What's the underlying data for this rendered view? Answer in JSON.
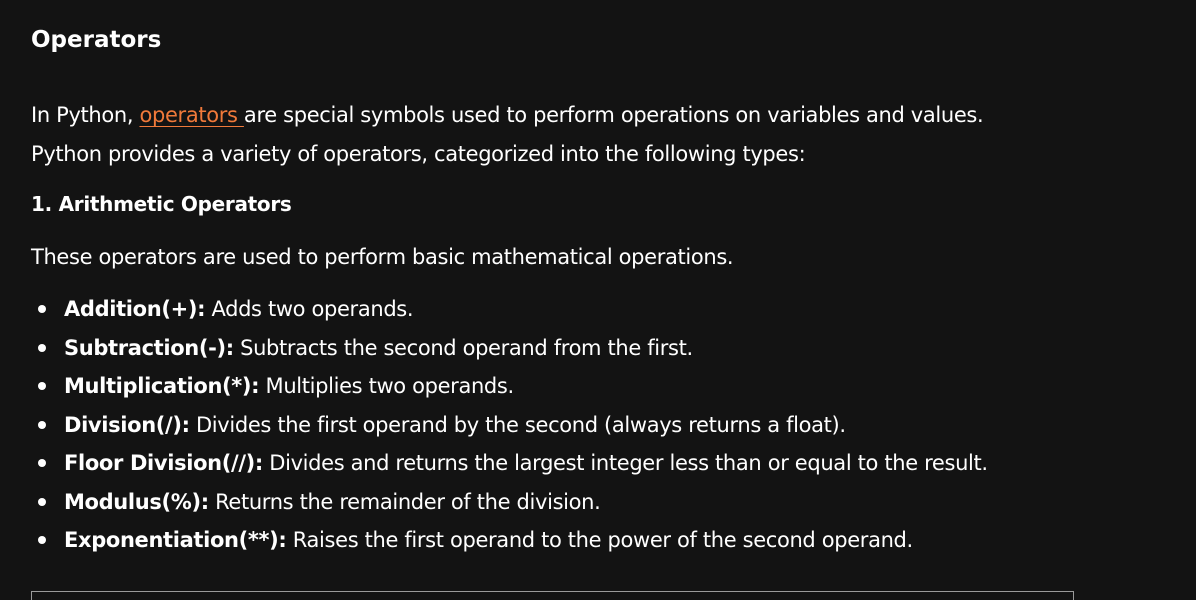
{
  "section_title": "Operators",
  "intro": {
    "prefix": "In Python, ",
    "link_text": "operators ",
    "line1_rest": "are special symbols used to perform operations on variables and values.",
    "line2": "Python provides a variety of operators, categorized into the following types:"
  },
  "arithmetic": {
    "heading": "1. Arithmetic Operators",
    "description": "These operators are used to perform basic mathematical operations.",
    "items": [
      {
        "name": "Addition(+):",
        "text": " Adds two operands."
      },
      {
        "name": "Subtraction(-):",
        "text": " Subtracts the second operand from the first."
      },
      {
        "name": "Multiplication(*):",
        "text": " Multiplies two operands."
      },
      {
        "name": "Division(/):",
        "text": " Divides the first operand by the second (always returns a float)."
      },
      {
        "name": "Floor Division(//):",
        "text": " Divides and returns the largest integer less than or equal to the result."
      },
      {
        "name": "Modulus(%):",
        "text": " Returns the remainder of the division."
      },
      {
        "name": "Exponentiation(**):",
        "text": " Raises the first operand to the power of the second operand."
      }
    ]
  },
  "colors": {
    "background": "#131313",
    "text": "#ffffff",
    "link": "#f0793a"
  }
}
